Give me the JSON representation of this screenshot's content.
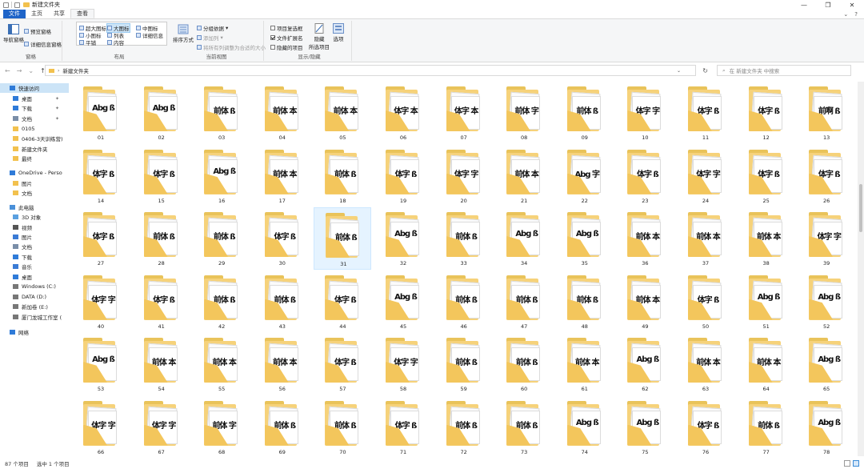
{
  "window": {
    "title": "新建文件夹",
    "controls": [
      "—",
      "❐",
      "✕"
    ]
  },
  "tabs": [
    {
      "label": "文件",
      "kind": "file"
    },
    {
      "label": "主页"
    },
    {
      "label": "共享"
    },
    {
      "label": "查看",
      "active": true
    }
  ],
  "ribbon": {
    "nav_pane": {
      "big_label": "导航窗格",
      "preview": "预览窗格",
      "details": "详细信息窗格",
      "group_title": "窗格"
    },
    "layout": {
      "group_title": "布局",
      "options": [
        [
          "超大图标",
          "大图标",
          "中图标"
        ],
        [
          "小图标",
          "列表",
          "详细信息"
        ],
        [
          "平铺",
          "内容",
          ""
        ]
      ],
      "selected": "大图标"
    },
    "current_view": {
      "sort_label": "排序方式",
      "group_by": "分组依据",
      "add_column": "添加列",
      "fit_columns": "将所有列调整为合适的大小",
      "group_title": "当前视图"
    },
    "show_hide": {
      "item_checkboxes": "项目复选框",
      "file_extensions": "文件扩展名",
      "hidden_items": "隐藏的项目",
      "hide_selected": "隐藏\n所选项目",
      "options": "选项",
      "group_title": "显示/隐藏",
      "checked": {
        "item_checkboxes": false,
        "file_extensions": true,
        "hidden_items": false
      }
    }
  },
  "address": {
    "path": "新建文件夹",
    "search_placeholder": "在 新建文件夹 中搜索"
  },
  "sidebar": [
    {
      "label": "快速访问",
      "icon": "star-icon",
      "level": 0,
      "selected": true
    },
    {
      "label": "桌面",
      "icon": "desktop-icon",
      "level": 1,
      "pinned": true
    },
    {
      "label": "下载",
      "icon": "download-icon",
      "level": 1,
      "pinned": true
    },
    {
      "label": "文档",
      "icon": "document-icon",
      "level": 1,
      "pinned": true
    },
    {
      "label": "0105",
      "icon": "folder-icon",
      "level": 1
    },
    {
      "label": "0406-3天训练营)",
      "icon": "folder-icon",
      "level": 1
    },
    {
      "label": "新建文件夹",
      "icon": "folder-icon",
      "level": 1
    },
    {
      "label": "最终",
      "icon": "folder-icon",
      "level": 1
    },
    {
      "label": "OneDrive - Perso",
      "icon": "cloud-icon",
      "level": 0
    },
    {
      "label": "图片",
      "icon": "folder-icon",
      "level": 1
    },
    {
      "label": "文档",
      "icon": "folder-icon",
      "level": 1
    },
    {
      "label": "此电脑",
      "icon": "computer-icon",
      "level": 0
    },
    {
      "label": "3D 对象",
      "icon": "cube-icon",
      "level": 1
    },
    {
      "label": "视频",
      "icon": "video-icon",
      "level": 1
    },
    {
      "label": "图片",
      "icon": "picture-icon",
      "level": 1
    },
    {
      "label": "文档",
      "icon": "document-icon",
      "level": 1
    },
    {
      "label": "下载",
      "icon": "download-icon",
      "level": 1
    },
    {
      "label": "音乐",
      "icon": "music-icon",
      "level": 1
    },
    {
      "label": "桌面",
      "icon": "desktop-icon",
      "level": 1
    },
    {
      "label": "Windows (C:)",
      "icon": "drive-icon",
      "level": 1
    },
    {
      "label": "DATA (D:)",
      "icon": "drive-icon",
      "level": 1
    },
    {
      "label": "新加卷 (E:)",
      "icon": "drive-icon",
      "level": 1
    },
    {
      "label": "厦门龙城工作室 (",
      "icon": "network-drive-icon",
      "level": 1
    },
    {
      "label": "网络",
      "icon": "network-icon",
      "level": 0
    }
  ],
  "folders": {
    "selected": "31",
    "items": [
      {
        "name": "01",
        "preview": "Abg ß"
      },
      {
        "name": "02",
        "preview": "Abg ß"
      },
      {
        "name": "03",
        "preview": "前体 ß"
      },
      {
        "name": "04",
        "preview": "前体 本"
      },
      {
        "name": "05",
        "preview": "前体 本"
      },
      {
        "name": "06",
        "preview": "体字 本"
      },
      {
        "name": "07",
        "preview": "体字 本"
      },
      {
        "name": "08",
        "preview": "前体 字"
      },
      {
        "name": "09",
        "preview": "前体 ß"
      },
      {
        "name": "10",
        "preview": "体字 字"
      },
      {
        "name": "11",
        "preview": "体字 ß"
      },
      {
        "name": "12",
        "preview": "体字 ß"
      },
      {
        "name": "13",
        "preview": "前啊 ß"
      },
      {
        "name": "14",
        "preview": "体字 ß"
      },
      {
        "name": "15",
        "preview": "体字 ß"
      },
      {
        "name": "16",
        "preview": "Abg ß"
      },
      {
        "name": "17",
        "preview": "前体 本"
      },
      {
        "name": "18",
        "preview": "前体 ß"
      },
      {
        "name": "19",
        "preview": "体字 ß"
      },
      {
        "name": "20",
        "preview": "体字 字"
      },
      {
        "name": "21",
        "preview": "前体 本"
      },
      {
        "name": "22",
        "preview": "Abg 字"
      },
      {
        "name": "23",
        "preview": "体字 ß"
      },
      {
        "name": "24",
        "preview": "体字 字"
      },
      {
        "name": "25",
        "preview": "体字 ß"
      },
      {
        "name": "26",
        "preview": "体字 ß"
      },
      {
        "name": "27",
        "preview": "体字 ß"
      },
      {
        "name": "28",
        "preview": "前体 ß"
      },
      {
        "name": "29",
        "preview": "前体 ß"
      },
      {
        "name": "30",
        "preview": "体字 ß"
      },
      {
        "name": "31",
        "preview": "前体 ß"
      },
      {
        "name": "32",
        "preview": "Abg ß"
      },
      {
        "name": "33",
        "preview": "前体 ß"
      },
      {
        "name": "34",
        "preview": "Abg ß"
      },
      {
        "name": "35",
        "preview": "Abg ß"
      },
      {
        "name": "36",
        "preview": "前体 本"
      },
      {
        "name": "37",
        "preview": "前体 本"
      },
      {
        "name": "38",
        "preview": "前体 本"
      },
      {
        "name": "39",
        "preview": "体字 字"
      },
      {
        "name": "40",
        "preview": "体字 字"
      },
      {
        "name": "41",
        "preview": "体字 ß"
      },
      {
        "name": "42",
        "preview": "前体 ß"
      },
      {
        "name": "43",
        "preview": "前体 ß"
      },
      {
        "name": "44",
        "preview": "体字 ß"
      },
      {
        "name": "45",
        "preview": "Abg ß"
      },
      {
        "name": "46",
        "preview": "前体 ß"
      },
      {
        "name": "47",
        "preview": "前体 ß"
      },
      {
        "name": "48",
        "preview": "前体 ß"
      },
      {
        "name": "49",
        "preview": "前体 本"
      },
      {
        "name": "50",
        "preview": "体字 ß"
      },
      {
        "name": "51",
        "preview": "Abg ß"
      },
      {
        "name": "52",
        "preview": "Abg ß"
      },
      {
        "name": "53",
        "preview": "Abg ß"
      },
      {
        "name": "54",
        "preview": "前体 本"
      },
      {
        "name": "55",
        "preview": "前体 本"
      },
      {
        "name": "56",
        "preview": "前体 本"
      },
      {
        "name": "57",
        "preview": "体字 ß"
      },
      {
        "name": "58",
        "preview": "体字 字"
      },
      {
        "name": "59",
        "preview": "前体 ß"
      },
      {
        "name": "60",
        "preview": "前体 ß"
      },
      {
        "name": "61",
        "preview": "前体 本"
      },
      {
        "name": "62",
        "preview": "Abg ß"
      },
      {
        "name": "63",
        "preview": "前体 本"
      },
      {
        "name": "64",
        "preview": "前体 本"
      },
      {
        "name": "65",
        "preview": "Abg ß"
      },
      {
        "name": "66",
        "preview": "体字 字"
      },
      {
        "name": "67",
        "preview": "体字 字"
      },
      {
        "name": "68",
        "preview": "前体 字"
      },
      {
        "name": "69",
        "preview": "前体 ß"
      },
      {
        "name": "70",
        "preview": "前体 ß"
      },
      {
        "name": "71",
        "preview": "体字 ß"
      },
      {
        "name": "72",
        "preview": "前体 ß"
      },
      {
        "name": "73",
        "preview": "前体 ß"
      },
      {
        "name": "74",
        "preview": "Abg ß"
      },
      {
        "name": "75",
        "preview": "Abg ß"
      },
      {
        "name": "76",
        "preview": "体字 ß"
      },
      {
        "name": "77",
        "preview": "前体 ß"
      },
      {
        "name": "78",
        "preview": "Abg ß"
      }
    ]
  },
  "status": {
    "count": "87 个项目",
    "selection": "选中 1 个项目"
  },
  "colors": {
    "file_tab": "#1e64c8",
    "selection": "#cce4f7",
    "folder": "#f6d27a"
  }
}
